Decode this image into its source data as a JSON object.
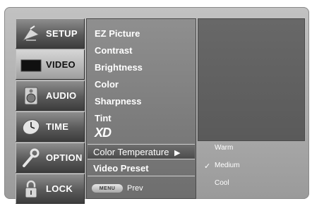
{
  "main_menu": [
    {
      "label": "SETUP",
      "icon": "satellite-dish-icon"
    },
    {
      "label": "VIDEO",
      "icon": "screen-icon"
    },
    {
      "label": "AUDIO",
      "icon": "speaker-icon"
    },
    {
      "label": "TIME",
      "icon": "clock-icon"
    },
    {
      "label": "OPTION",
      "icon": "wrench-icon"
    },
    {
      "label": "LOCK",
      "icon": "padlock-icon"
    }
  ],
  "submenu": {
    "items": [
      "EZ Picture",
      "Contrast",
      "Brightness",
      "Color",
      "Sharpness",
      "Tint"
    ],
    "xd_logo": "XD",
    "color_temperature": "Color Temperature",
    "arrow": "▶",
    "video_preset": "Video Preset",
    "menu_pill": "MENU",
    "prev": "Prev"
  },
  "color_temp_options": {
    "items": [
      "Warm",
      "Medium",
      "Cool"
    ],
    "selected": "Medium",
    "check": "✓"
  }
}
